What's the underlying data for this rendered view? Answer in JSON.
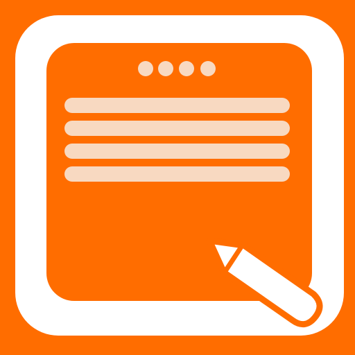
{
  "icon": {
    "name": "notepad-app-icon",
    "depicts": [
      "note-card-icon",
      "text-lines",
      "pencil-icon"
    ]
  },
  "colors": {
    "background": "#FF6D00",
    "frame": "#FFFFFF",
    "note_card": "#FF6D00",
    "text_lines": "#F8D9C1",
    "binding_dots": "#F8D9C1",
    "pencil_body": "#FFFFFF",
    "pencil_outline": "#FF6D00"
  },
  "note": {
    "binding_dot_count": 4,
    "text_line_count": 4
  }
}
